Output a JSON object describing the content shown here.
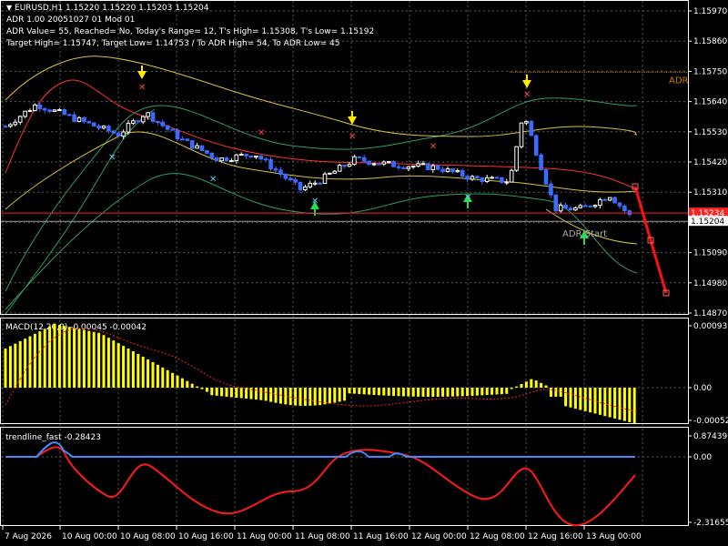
{
  "window": {
    "symbol_line": "EURUSD,H1  1.15220 1.15220 1.15203 1.15204",
    "adr_line1": "ADR 1.00 20051027 01 Mod 01",
    "adr_line2": "ADR Value= 55, Reached= No, Today's Range= 12, T's High= 1.15308, T's Low= 1.15192",
    "adr_line3": "Target High= 1.15747, Target Low= 1.14753 / To ADR High= 54, To ADR Low= 45"
  },
  "main_chart": {
    "price_ticks": [
      "1.15970",
      "1.15860",
      "1.15750",
      "1.15640",
      "1.15530",
      "1.15420",
      "1.15310",
      "1.15200",
      "1.15090",
      "1.14980",
      "1.14870"
    ],
    "red_line_label": "1.15234",
    "bid_label": "1.15204",
    "adr_text": "ADR",
    "adr_start_text": "ADR Start",
    "colors": {
      "bull": "#ffffff",
      "bear": "#3b6bff",
      "red_line": "#ff2020",
      "target": "#ff0000"
    }
  },
  "macd": {
    "title": "MACD(12,26,9) -0.00045 -0.00042",
    "ticks": [
      "0.00093",
      "0.00",
      "-0.00052"
    ],
    "colors": {
      "hist": "#ffff00",
      "signal": "#ff2020"
    }
  },
  "trendline": {
    "title": "trendline_fast -0.28423",
    "ticks": [
      "0.87439",
      "0.00",
      "-2.31655"
    ],
    "colors": {
      "fast": "#ff1a1a",
      "slow": "#3a8cff"
    }
  },
  "time_axis": {
    "labels": [
      "7 Aug 2026",
      "10 Aug 00:00",
      "10 Aug 08:00",
      "10 Aug 16:00",
      "11 Aug 00:00",
      "11 Aug 08:00",
      "11 Aug 16:00",
      "12 Aug 00:00",
      "12 Aug 08:00",
      "12 Aug 16:00",
      "13 Aug 00:00"
    ]
  }
}
